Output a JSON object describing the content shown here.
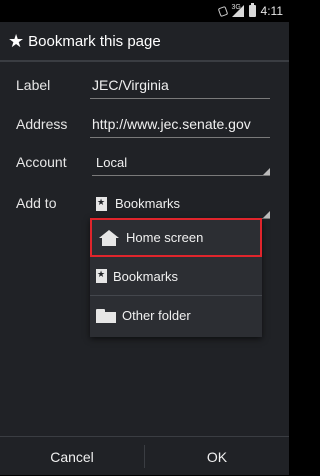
{
  "status_bar": {
    "time": "4:11",
    "network": "3G"
  },
  "dialog": {
    "title": "Bookmark this page",
    "label_label": "Label",
    "label_value": "JEC/Virginia",
    "address_label": "Address",
    "address_value": "http://www.jec.senate.gov",
    "account_label": "Account",
    "account_value": "Local",
    "addto_label": "Add to",
    "addto_value": "Bookmarks"
  },
  "dropdown": {
    "items": [
      {
        "label": "Home screen",
        "icon": "home-icon"
      },
      {
        "label": "Bookmarks",
        "icon": "bookmark-icon"
      },
      {
        "label": "Other folder",
        "icon": "folder-icon"
      }
    ]
  },
  "buttons": {
    "cancel": "Cancel",
    "ok": "OK"
  },
  "colors": {
    "highlight": "#e0252c",
    "dialog_bg": "#202226"
  }
}
